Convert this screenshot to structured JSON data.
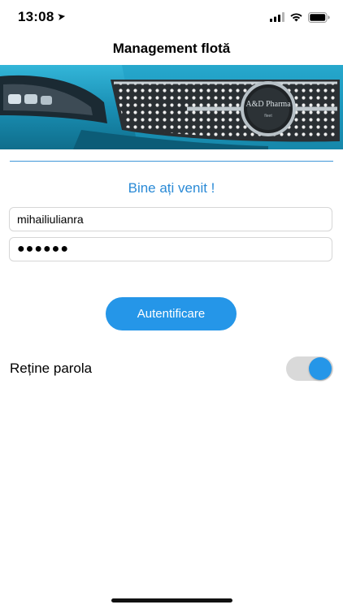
{
  "status_bar": {
    "time": "13:08",
    "icons": [
      "location-arrow-icon",
      "signal-icon",
      "wifi-icon",
      "battery-icon"
    ]
  },
  "nav": {
    "title": "Management flotă"
  },
  "hero": {
    "image": "car-front-grille-photo"
  },
  "welcome": "Bine ați venit !",
  "login": {
    "username": "mihailiulianra",
    "password_dots": "●●●●●●",
    "submit_label": "Autentificare"
  },
  "remember": {
    "label": "Reține parola",
    "enabled": true
  },
  "colors": {
    "accent": "#2596e8",
    "welcome_text": "#2a8ad6",
    "divider": "#3f97d8",
    "toggle_track": "#d9d9d9"
  }
}
